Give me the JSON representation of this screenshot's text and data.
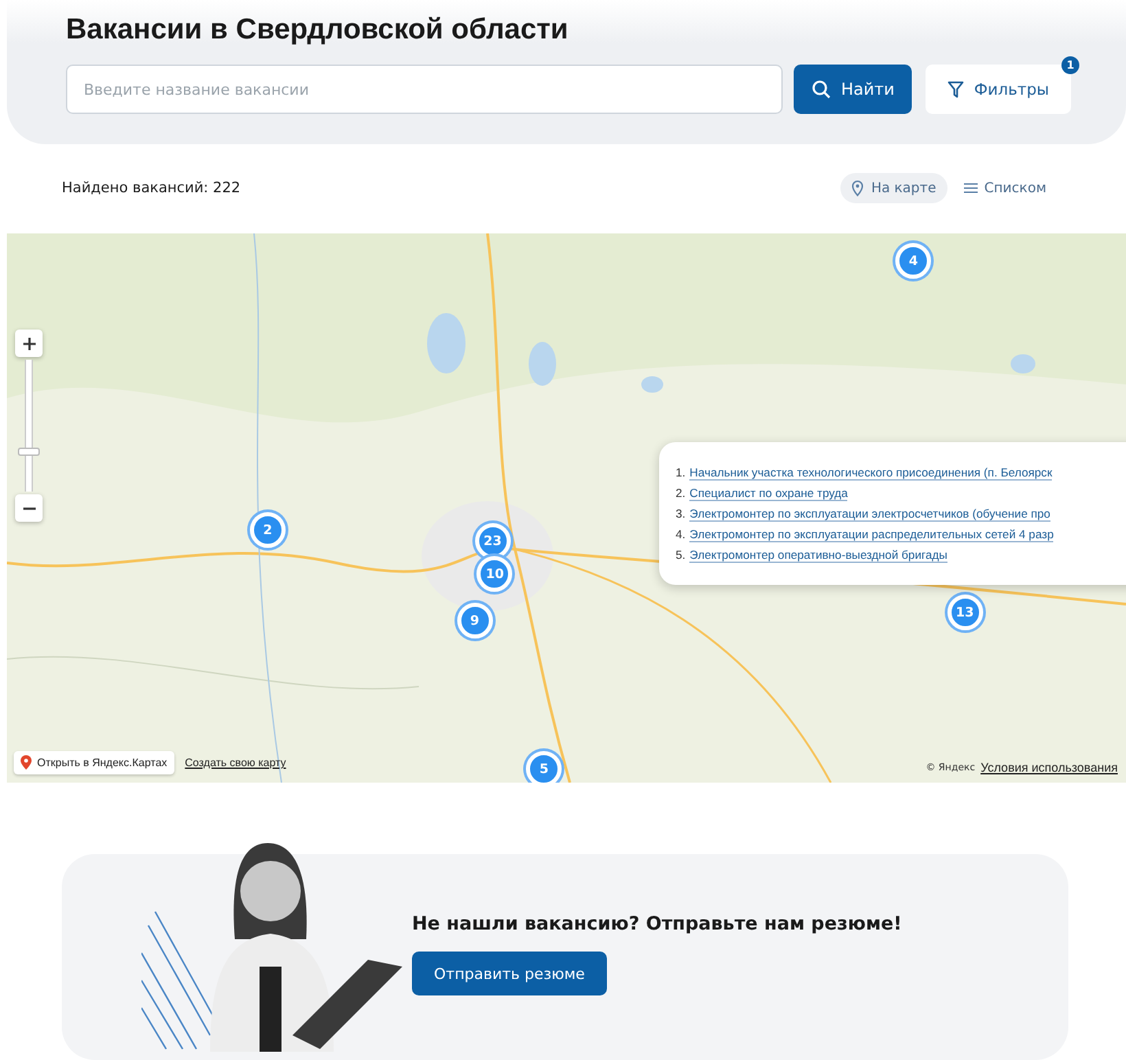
{
  "header": {
    "title": "Вакансии в Свердловской области",
    "search": {
      "placeholder": "Введите название вакансии"
    },
    "search_button": "Найти",
    "filters_button": {
      "label": "Фильтры",
      "badge": "1"
    }
  },
  "results": {
    "count_text": "Найдено вакансий: 222",
    "views": [
      {
        "label": "На карте",
        "kind": "map",
        "selected": true
      },
      {
        "label": "Списком",
        "kind": "list",
        "selected": false
      }
    ]
  },
  "map": {
    "zoom": {
      "level": 0.3
    },
    "clusters": [
      {
        "count": "4"
      },
      {
        "count": "2"
      },
      {
        "count": "23"
      },
      {
        "count": "10"
      },
      {
        "count": "9"
      },
      {
        "count": "13"
      },
      {
        "count": "5"
      }
    ],
    "popup": {
      "items": [
        {
          "number": "1.",
          "title": "Начальник участка технологического присоединения (п. Белоярск"
        },
        {
          "number": "2.",
          "title": "Специалист по охране труда"
        },
        {
          "number": "3.",
          "title": "Электромонтер по эксплуатации электросчетчиков (обучение про"
        },
        {
          "number": "4.",
          "title": "Электромонтер по эксплуатации распределительных сетей 4 разр"
        },
        {
          "number": "5.",
          "title": "Электромонтер оперативно-выездной бригады"
        }
      ]
    },
    "open_link": "Открыть в Яндекс.Картах",
    "create_link": "Создать свою карту",
    "copyright": "© Яндекс",
    "terms_link": "Условия использования"
  },
  "banner": {
    "heading": "Не нашли вакансию? Отправьте нам резюме!",
    "button": "Отправить резюме"
  }
}
